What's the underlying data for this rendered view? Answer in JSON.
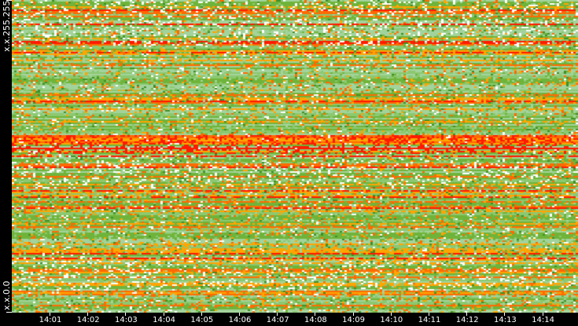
{
  "chart_data": {
    "type": "heatmap",
    "title": "",
    "ylabel_top": "x.x.255.255",
    "ylabel_bottom": "x.x.0.0",
    "x_ticks": [
      "14:01",
      "14:02",
      "14:03",
      "14:04",
      "14:05",
      "14:06",
      "14:07",
      "14:08",
      "14:09",
      "14:10",
      "14:11",
      "14:12",
      "14:13",
      "14:14"
    ],
    "palette": [
      "#ffffff",
      "#a3d39c",
      "#8cc870",
      "#6fb43a",
      "#3f8f2a",
      "#ffa500",
      "#ff6a00",
      "#ff1a00"
    ],
    "background": "#000000"
  }
}
